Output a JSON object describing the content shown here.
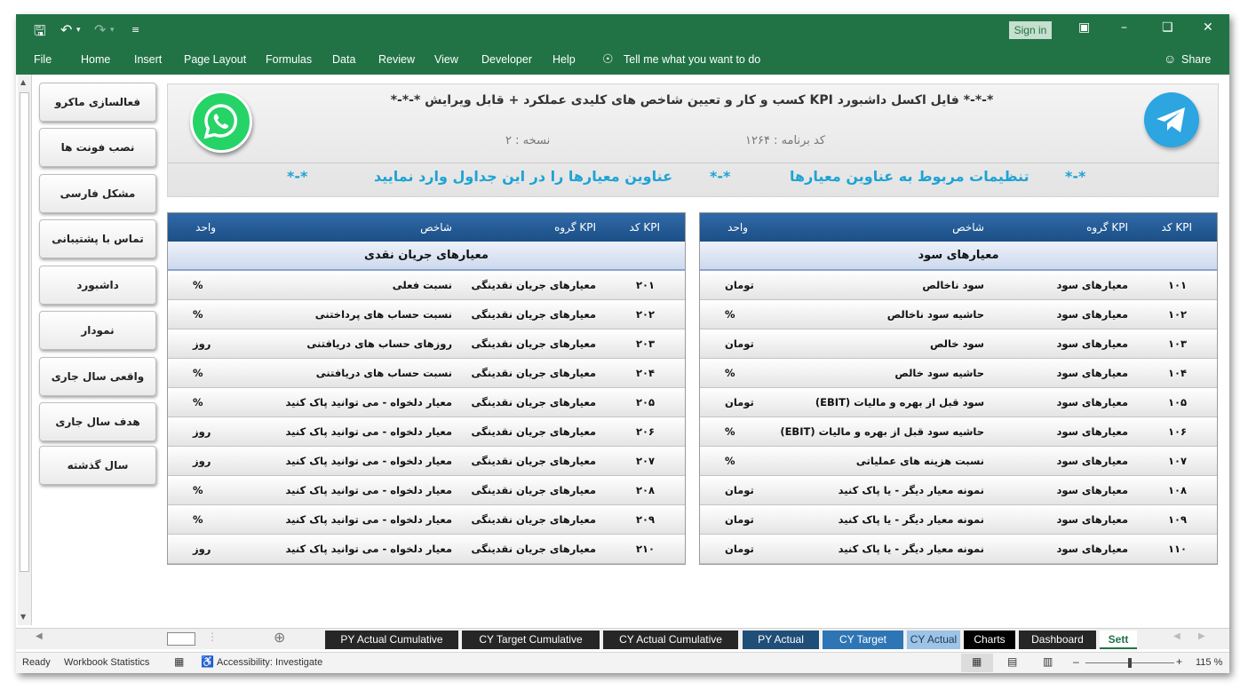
{
  "ribbon": {
    "tabs": [
      "File",
      "Home",
      "Insert",
      "Page Layout",
      "Formulas",
      "Data",
      "Review",
      "View",
      "Developer",
      "Help"
    ],
    "tell_me": "Tell me what you want to do",
    "share": "Share",
    "sign_in": "Sign in"
  },
  "macro_buttons": [
    "فعالسازی ماکرو",
    "نصب فونت ها",
    "مشکل فارسی",
    "تماس با پشتیبانی",
    "داشبورد",
    "نمودار",
    "واقعی سال جاری",
    "هدف سال جاری",
    "سال گذشته"
  ],
  "header": {
    "title": "*-*-* فایل اکسل داشبورد KPI کسب و کار و تعیین شاخص های کلیدی عملکرد + قابل ویرایش *-*-*",
    "program_code": "کد برنامه : ۱۲۶۴",
    "version": "نسخه : ۲",
    "stars1": "*-*",
    "settings_title": "تنظیمات مربوط به عناوین معیارها",
    "stars2": "*-*",
    "instruction": "عناوین معیارها را در این جداول وارد نمایید",
    "stars3": "*-*"
  },
  "table_headers": {
    "code": "کد KPI",
    "group": "گروه KPI",
    "indicator": "شاخص",
    "unit": "واحد"
  },
  "profit_table": {
    "group_title": "معیارهای سود",
    "rows": [
      {
        "code": "۱۰۱",
        "group": "معیارهای سود",
        "indicator": "سود ناخالص",
        "unit": "تومان"
      },
      {
        "code": "۱۰۲",
        "group": "معیارهای سود",
        "indicator": "حاشیه سود ناخالص",
        "unit": "%"
      },
      {
        "code": "۱۰۳",
        "group": "معیارهای سود",
        "indicator": "سود خالص",
        "unit": "تومان"
      },
      {
        "code": "۱۰۴",
        "group": "معیارهای سود",
        "indicator": "حاشیه سود خالص",
        "unit": "%"
      },
      {
        "code": "۱۰۵",
        "group": "معیارهای سود",
        "indicator": "سود قبل از بهره و مالیات (EBIT)",
        "unit": "تومان"
      },
      {
        "code": "۱۰۶",
        "group": "معیارهای سود",
        "indicator": "حاشیه سود قبل از بهره و مالیات (EBIT)",
        "unit": "%"
      },
      {
        "code": "۱۰۷",
        "group": "معیارهای سود",
        "indicator": "نسبت هزینه های عملیاتی",
        "unit": "%"
      },
      {
        "code": "۱۰۸",
        "group": "معیارهای سود",
        "indicator": "نمونه معیار دیگر - یا پاک کنید",
        "unit": "تومان"
      },
      {
        "code": "۱۰۹",
        "group": "معیارهای سود",
        "indicator": "نمونه معیار دیگر - یا پاک کنید",
        "unit": "تومان"
      },
      {
        "code": "۱۱۰",
        "group": "معیارهای سود",
        "indicator": "نمونه معیار دیگر - یا پاک کنید",
        "unit": "تومان"
      }
    ]
  },
  "cash_table": {
    "group_title": "معیارهای جریان نقدی",
    "rows": [
      {
        "code": "۲۰۱",
        "group": "معیارهای جریان نقدینگی",
        "indicator": "نسبت فعلی",
        "unit": "%"
      },
      {
        "code": "۲۰۲",
        "group": "معیارهای جریان نقدینگی",
        "indicator": "نسبت حساب های پرداختنی",
        "unit": "%"
      },
      {
        "code": "۲۰۳",
        "group": "معیارهای جریان نقدینگی",
        "indicator": "روزهای حساب های دریافتنی",
        "unit": "روز"
      },
      {
        "code": "۲۰۴",
        "group": "معیارهای جریان نقدینگی",
        "indicator": "نسبت حساب های دریافتنی",
        "unit": "%"
      },
      {
        "code": "۲۰۵",
        "group": "معیارهای جریان نقدینگی",
        "indicator": "معیار دلخواه - می توانید پاک کنید",
        "unit": "%"
      },
      {
        "code": "۲۰۶",
        "group": "معیارهای جریان نقدینگی",
        "indicator": "معیار دلخواه - می توانید پاک کنید",
        "unit": "روز"
      },
      {
        "code": "۲۰۷",
        "group": "معیارهای جریان نقدینگی",
        "indicator": "معیار دلخواه - می توانید پاک کنید",
        "unit": "روز"
      },
      {
        "code": "۲۰۸",
        "group": "معیارهای جریان نقدینگی",
        "indicator": "معیار دلخواه - می توانید پاک کنید",
        "unit": "%"
      },
      {
        "code": "۲۰۹",
        "group": "معیارهای جریان نقدینگی",
        "indicator": "معیار دلخواه - می توانید پاک کنید",
        "unit": "%"
      },
      {
        "code": "۲۱۰",
        "group": "معیارهای جریان نقدینگی",
        "indicator": "معیار دلخواه - می توانید پاک کنید",
        "unit": "روز"
      }
    ]
  },
  "sheet_tabs": [
    {
      "label": "PY Actual Cumulative",
      "color": "#262626"
    },
    {
      "label": "CY Target Cumulative",
      "color": "#262626"
    },
    {
      "label": "CY Actual Cumulative",
      "color": "#262626"
    },
    {
      "label": "PY Actual",
      "color": "#1f4e79"
    },
    {
      "label": "CY Target",
      "color": "#2e75b6"
    },
    {
      "label": "CY Actual",
      "color": "#9dc3e6"
    },
    {
      "label": "Charts",
      "color": "#000000"
    },
    {
      "label": "Dashboard",
      "color": "#262626"
    },
    {
      "label": "Sett",
      "color": "#ffffff"
    }
  ],
  "status_bar": {
    "ready": "Ready",
    "workbook_statistics": "Workbook Statistics",
    "accessibility": "Accessibility: Investigate",
    "zoom": "115 %"
  }
}
